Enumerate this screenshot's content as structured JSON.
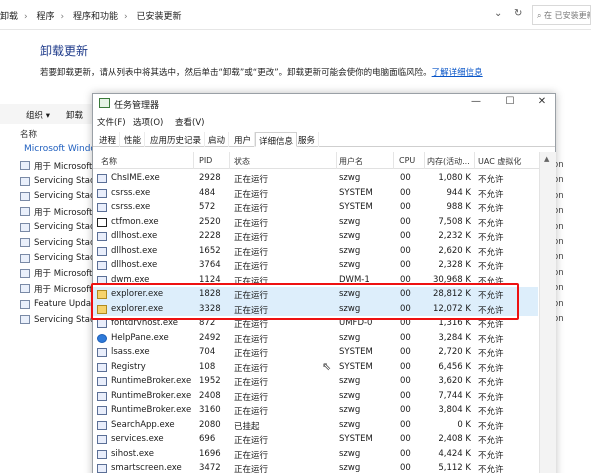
{
  "background": {
    "breadcrumb": [
      "卸载",
      "程序",
      "程序和功能",
      "已安装更新"
    ],
    "search_placeholder": "在 已安装更新",
    "title": "卸载更新",
    "description": "若要卸载更新，请从列表中将其选中，然后单击“卸载”或“更改”。卸载更新可能会使你的电脑面临风险。",
    "learn_more": "了解详细信息",
    "toolbar": {
      "organize": "组织 ▾",
      "uninstall": "卸载"
    },
    "col_name": "名称",
    "group": "Microsoft Windo",
    "items": [
      "用于 Microsoft",
      "Servicing Stack",
      "Servicing Stack",
      "用于 Microsoft",
      "Servicing Stack",
      "Servicing Stack",
      "Servicing Stack",
      "用于 Microsoft",
      "用于 Microsoft",
      "Feature Updat",
      "Servicing Stac"
    ],
    "right_suffixes": [
      "on",
      "on",
      "on",
      "on",
      "on",
      "on",
      "on",
      "on",
      "on",
      "on",
      "on"
    ]
  },
  "taskmgr": {
    "title": "任务管理器",
    "menu": [
      "文件(F)",
      "选项(O)",
      "查看(V)"
    ],
    "tabs": [
      "进程",
      "性能",
      "应用历史记录",
      "启动",
      "用户",
      "详细信息",
      "服务"
    ],
    "active_tab": "详细信息",
    "columns": [
      "名称",
      "PID",
      "状态",
      "用户名",
      "CPU",
      "内存(活动...",
      "UAC 虚拟化"
    ],
    "rows": [
      {
        "name": "ChsIME.exe",
        "pid": "2928",
        "status": "正在运行",
        "user": "szwg",
        "cpu": "00",
        "mem": "1,080 K",
        "uac": "不允许",
        "icon": "process-icon"
      },
      {
        "name": "csrss.exe",
        "pid": "484",
        "status": "正在运行",
        "user": "SYSTEM",
        "cpu": "00",
        "mem": "944 K",
        "uac": "不允许",
        "icon": "process-icon"
      },
      {
        "name": "csrss.exe",
        "pid": "572",
        "status": "正在运行",
        "user": "SYSTEM",
        "cpu": "00",
        "mem": "988 K",
        "uac": "不允许",
        "icon": "process-icon"
      },
      {
        "name": "ctfmon.exe",
        "pid": "2520",
        "status": "正在运行",
        "user": "szwg",
        "cpu": "00",
        "mem": "7,508 K",
        "uac": "不允许",
        "icon": "pen-icon"
      },
      {
        "name": "dllhost.exe",
        "pid": "2228",
        "status": "正在运行",
        "user": "szwg",
        "cpu": "00",
        "mem": "2,232 K",
        "uac": "不允许",
        "icon": "process-icon"
      },
      {
        "name": "dllhost.exe",
        "pid": "1652",
        "status": "正在运行",
        "user": "szwg",
        "cpu": "00",
        "mem": "2,620 K",
        "uac": "不允许",
        "icon": "process-icon"
      },
      {
        "name": "dllhost.exe",
        "pid": "3764",
        "status": "正在运行",
        "user": "szwg",
        "cpu": "00",
        "mem": "2,328 K",
        "uac": "不允许",
        "icon": "process-icon"
      },
      {
        "name": "dwm.exe",
        "pid": "1124",
        "status": "正在运行",
        "user": "DWM-1",
        "cpu": "00",
        "mem": "30,968 K",
        "uac": "不允许",
        "icon": "process-icon"
      },
      {
        "name": "explorer.exe",
        "pid": "1828",
        "status": "正在运行",
        "user": "szwg",
        "cpu": "00",
        "mem": "28,812 K",
        "uac": "不允许",
        "icon": "folder-icon"
      },
      {
        "name": "explorer.exe",
        "pid": "3328",
        "status": "正在运行",
        "user": "szwg",
        "cpu": "00",
        "mem": "12,072 K",
        "uac": "不允许",
        "icon": "folder-icon"
      },
      {
        "name": "fontdrvhost.exe",
        "pid": "872",
        "status": "正在运行",
        "user": "UMFD-0",
        "cpu": "00",
        "mem": "1,316 K",
        "uac": "不允许",
        "icon": "process-icon"
      },
      {
        "name": "HelpPane.exe",
        "pid": "2492",
        "status": "正在运行",
        "user": "szwg",
        "cpu": "00",
        "mem": "3,284 K",
        "uac": "不允许",
        "icon": "help-icon"
      },
      {
        "name": "lsass.exe",
        "pid": "704",
        "status": "正在运行",
        "user": "SYSTEM",
        "cpu": "00",
        "mem": "2,720 K",
        "uac": "不允许",
        "icon": "process-icon"
      },
      {
        "name": "Registry",
        "pid": "108",
        "status": "正在运行",
        "user": "SYSTEM",
        "cpu": "00",
        "mem": "6,456 K",
        "uac": "不允许",
        "icon": "process-icon"
      },
      {
        "name": "RuntimeBroker.exe",
        "pid": "1952",
        "status": "正在运行",
        "user": "szwg",
        "cpu": "00",
        "mem": "3,620 K",
        "uac": "不允许",
        "icon": "process-icon"
      },
      {
        "name": "RuntimeBroker.exe",
        "pid": "2408",
        "status": "正在运行",
        "user": "szwg",
        "cpu": "00",
        "mem": "7,744 K",
        "uac": "不允许",
        "icon": "process-icon"
      },
      {
        "name": "RuntimeBroker.exe",
        "pid": "3160",
        "status": "正在运行",
        "user": "szwg",
        "cpu": "00",
        "mem": "3,804 K",
        "uac": "不允许",
        "icon": "process-icon"
      },
      {
        "name": "SearchApp.exe",
        "pid": "2080",
        "status": "已挂起",
        "user": "szwg",
        "cpu": "00",
        "mem": "0 K",
        "uac": "不允许",
        "icon": "process-icon"
      },
      {
        "name": "services.exe",
        "pid": "696",
        "status": "正在运行",
        "user": "SYSTEM",
        "cpu": "00",
        "mem": "2,408 K",
        "uac": "不允许",
        "icon": "process-icon"
      },
      {
        "name": "sihost.exe",
        "pid": "1696",
        "status": "正在运行",
        "user": "szwg",
        "cpu": "00",
        "mem": "4,424 K",
        "uac": "不允许",
        "icon": "process-icon"
      },
      {
        "name": "smartscreen.exe",
        "pid": "3472",
        "status": "正在运行",
        "user": "szwg",
        "cpu": "00",
        "mem": "5,112 K",
        "uac": "不允许",
        "icon": "process-icon"
      }
    ],
    "highlighted_rows": [
      8,
      9
    ],
    "highlight_color": "#e11111"
  }
}
